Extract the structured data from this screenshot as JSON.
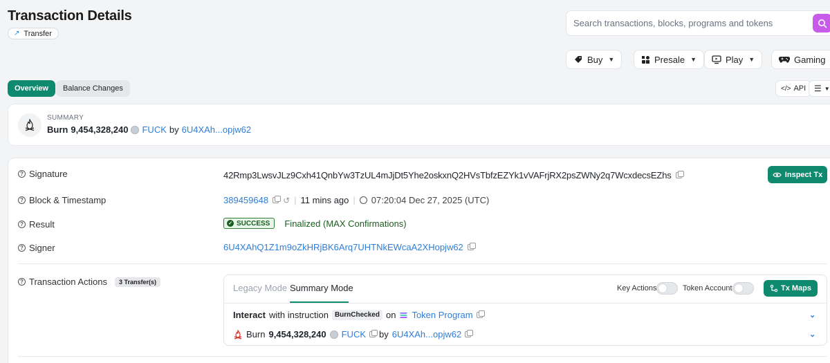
{
  "page": {
    "title": "Transaction Details",
    "type_badge": "Transfer"
  },
  "search": {
    "placeholder": "Search transactions, blocks, programs and tokens"
  },
  "nav": {
    "buy": "Buy",
    "presale": "Presale",
    "play": "Play",
    "gaming": "Gaming"
  },
  "tabs": {
    "overview": "Overview",
    "balance_changes": "Balance Changes"
  },
  "toolbar": {
    "api": "API"
  },
  "summary": {
    "label": "SUMMARY",
    "action": "Burn",
    "amount": "9,454,328,240",
    "token": "FUCK",
    "by": "by",
    "account": "6U4XAh...opjw62"
  },
  "details": {
    "signature_label": "Signature",
    "signature": "42Rmp3LwsvJLz9Cxh41QnbYw3TzUL4mJjDt5Yhe2oskxnQ2HVsTbfzEZYk1vVAFrjRX2psZWNy2q7WcxdecsEZhs",
    "inspect_label": "Inspect Tx",
    "block_label": "Block & Timestamp",
    "block": "389459648",
    "relative_time": "11 mins ago",
    "timestamp": "07:20:04 Dec 27, 2025 (UTC)",
    "result_label": "Result",
    "result_status": "SUCCESS",
    "result_text": "Finalized (MAX Confirmations)",
    "signer_label": "Signer",
    "signer": "6U4XAhQ1Z1m9oZkHRjBK6Arq7UHTNkEWcaA2XHopjw62",
    "actions_label": "Transaction Actions",
    "actions_badge": "3 Transfer(s)"
  },
  "actions": {
    "legacy_mode": "Legacy Mode",
    "summary_mode": "Summary Mode",
    "key_actions": "Key Actions",
    "token_account": "Token Account",
    "tx_maps": "Tx Maps",
    "row1": {
      "interact": "Interact",
      "with_instruction": "with instruction",
      "instruction": "BurnChecked",
      "on": "on",
      "program": "Token Program"
    },
    "row2": {
      "action": "Burn",
      "amount": "9,454,328,240",
      "token": "FUCK",
      "by": "by",
      "account": "6U4XAh...opjw62"
    }
  },
  "colors": {
    "primary": "#0f8a6e",
    "link": "#2f7ed8",
    "search_accent": "#c95bea",
    "success": "#1b5e20"
  }
}
